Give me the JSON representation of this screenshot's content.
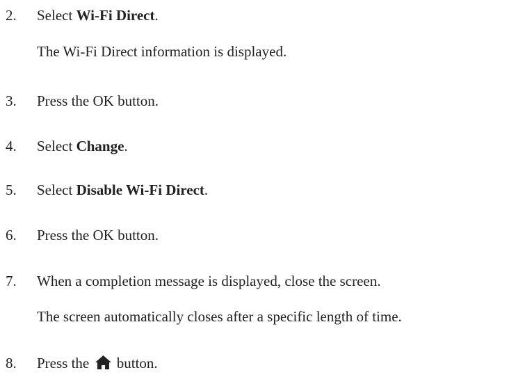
{
  "steps": [
    {
      "number": "2.",
      "prefix": "Select ",
      "bold": "Wi-Fi Direct",
      "suffix": ".",
      "note": "The Wi-Fi Direct information is displayed."
    },
    {
      "number": "3.",
      "text": "Press the OK button."
    },
    {
      "number": "4.",
      "prefix": "Select ",
      "bold": "Change",
      "suffix": "."
    },
    {
      "number": "5.",
      "prefix": "Select ",
      "bold": "Disable Wi-Fi Direct",
      "suffix": "."
    },
    {
      "number": "6.",
      "text": "Press the OK button."
    },
    {
      "number": "7.",
      "text": "When a completion message is displayed, close the screen.",
      "note": "The screen automatically closes after a specific length of time."
    },
    {
      "number": "8.",
      "prefix": "Press the ",
      "icon": "home-icon",
      "suffix": " button."
    }
  ]
}
